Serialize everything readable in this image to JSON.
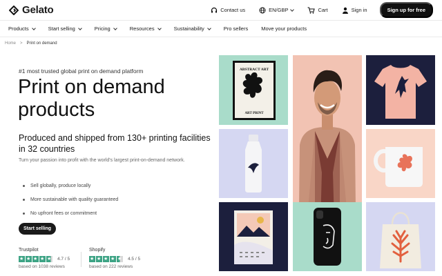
{
  "brand": {
    "name": "Gelato"
  },
  "header": {
    "contact": "Contact us",
    "locale": "EN/GBP",
    "cart": "Cart",
    "signin": "Sign in",
    "signup": "Sign up for free"
  },
  "nav": [
    {
      "label": "Products",
      "dropdown": true
    },
    {
      "label": "Start selling",
      "dropdown": true
    },
    {
      "label": "Pricing",
      "dropdown": true
    },
    {
      "label": "Resources",
      "dropdown": true
    },
    {
      "label": "Sustainability",
      "dropdown": true
    },
    {
      "label": "Pro sellers",
      "dropdown": false
    },
    {
      "label": "Move your products",
      "dropdown": false
    }
  ],
  "breadcrumb": {
    "home": "Home",
    "sep": ">",
    "current": "Print on demand"
  },
  "hero": {
    "eyebrow": "#1 most trusted global print on demand platform",
    "title": "Print on demand products",
    "subtitle": "Produced and shipped from 130+ printing facilities in 32 countries",
    "description": "Turn your passion into profit with the world's largest print-on-demand network.",
    "bullets": [
      "Sell globally, produce locally",
      "More sustainable with quality guaranteed",
      "No upfront fees or commitment"
    ],
    "cta": "Start selling"
  },
  "reviews": [
    {
      "source": "Trustpilot",
      "score": "4.7 / 5",
      "stars": 4.7,
      "based": "based on 1038 reviews"
    },
    {
      "source": "Shopify",
      "score": "4.5 / 5",
      "stars": 4.5,
      "based": "based on 222 reviews"
    }
  ],
  "gallery": {
    "poster_title": "ABSTRACT ART",
    "poster_caption": "ART PRINT"
  },
  "colors": {
    "accent_green": "#3ca384",
    "mint": "#a9dcca",
    "peach": "#f2c3b3",
    "navy": "#1c1f3d",
    "lavender": "#d5d7f2"
  }
}
